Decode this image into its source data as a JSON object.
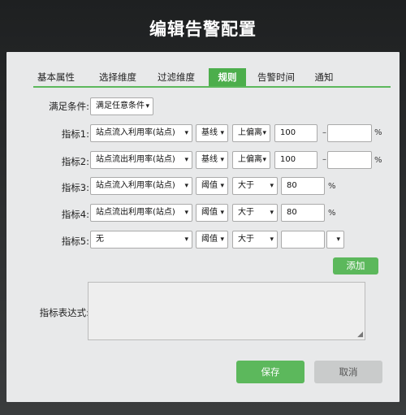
{
  "dialog": {
    "title": "编辑告警配置",
    "tabs": [
      "基本属性",
      "选择维度",
      "过滤维度",
      "规则",
      "告警时间",
      "通知"
    ],
    "active_tab": "规则"
  },
  "condition": {
    "label": "满足条件:",
    "value": "满足任意条件"
  },
  "metrics": [
    {
      "label": "指标1:",
      "metric": "站点流入利用率(站点)",
      "mode": "基线",
      "op": "上偏离",
      "value": "100",
      "dash": "–",
      "value2": "",
      "unit": "%"
    },
    {
      "label": "指标2:",
      "metric": "站点流出利用率(站点)",
      "mode": "基线",
      "op": "上偏离",
      "value": "100",
      "dash": "–",
      "value2": "",
      "unit": "%"
    },
    {
      "label": "指标3:",
      "metric": "站点流入利用率(站点)",
      "mode": "阈值",
      "op": "大于",
      "value": "80",
      "unit": "%"
    },
    {
      "label": "指标4:",
      "metric": "站点流出利用率(站点)",
      "mode": "阈值",
      "op": "大于",
      "value": "80",
      "unit": "%"
    },
    {
      "label": "指标5:",
      "metric": "无",
      "mode": "阈值",
      "op": "大于",
      "value": "",
      "unit_select": ""
    }
  ],
  "add_button": "添加",
  "expression": {
    "label": "指标表达式:",
    "value": ""
  },
  "footer": {
    "save": "保存",
    "cancel": "取消"
  },
  "colors": {
    "accent": "#5cb85c",
    "tab_active": "#4cae4c",
    "cancel": "#c9cbcb"
  }
}
